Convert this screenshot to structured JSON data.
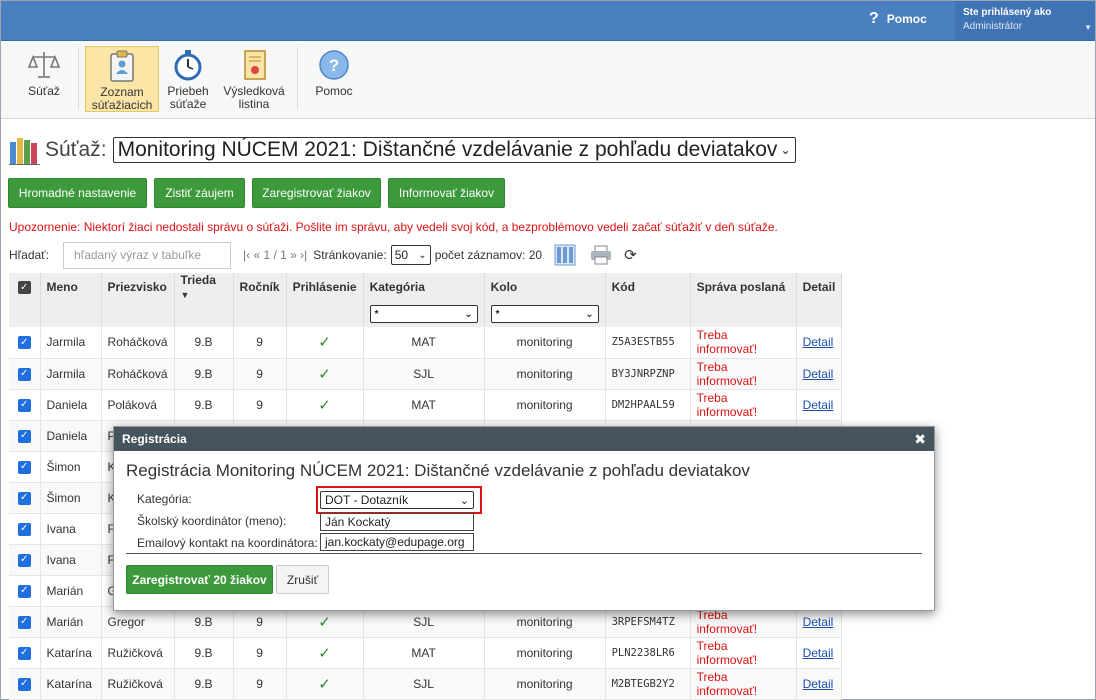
{
  "header": {
    "help": "Pomoc",
    "logged_in_label": "Ste prihlásený ako",
    "user": "Administrátor"
  },
  "toolbar": {
    "items": [
      {
        "label1": "Súťaž",
        "label2": "",
        "icon": "scales-icon"
      },
      {
        "label1": "Zoznam",
        "label2": "súťažiacich",
        "icon": "clipboard-icon"
      },
      {
        "label1": "Priebeh",
        "label2": "súťaže",
        "icon": "stopwatch-icon"
      },
      {
        "label1": "Výsledková",
        "label2": "listina",
        "icon": "certificate-icon"
      },
      {
        "label1": "Pomoc",
        "label2": "",
        "icon": "help-icon"
      }
    ]
  },
  "contest": {
    "label": "Súťaž:",
    "selected": "Monitoring NÚCEM 2021: Dištančné vzdelávanie z pohľadu deviatakov"
  },
  "actions": {
    "bulk": "Hromadné nastavenie",
    "interest": "Zistiť záujem",
    "register": "Zaregistrovať žiakov",
    "inform": "Informovať žiakov"
  },
  "warning": "Upozornenie: Niektorí žiaci nedostali správu o súťaži. Pošlite im správu, aby vedeli svoj kód, a bezproblémovo vedeli začať súťažiť v deň súťaže.",
  "search": {
    "label": "Hľadať:",
    "placeholder": "hľadaný výraz v tabuľke",
    "pager": "|‹ « 1 / 1 » ›|",
    "paging_label": "Stránkovanie:",
    "per_page": "50",
    "count": "počet záznamov: 20"
  },
  "table": {
    "headers": {
      "first": "Meno",
      "last": "Priezvisko",
      "class": "Trieda",
      "year": "Ročník",
      "login": "Prihlásenie",
      "category": "Kategória",
      "round": "Kolo",
      "code": "Kód",
      "msg": "Správa poslaná",
      "detail": "Detail"
    },
    "filter_all": "*",
    "detail_link": "Detail",
    "msg_status": "Treba informovať!",
    "rows": [
      {
        "first": "Jarmila",
        "last": "Roháčková",
        "class": "9.B",
        "year": "9",
        "category": "MAT",
        "round": "monitoring",
        "code": "Z5A3ESTB55"
      },
      {
        "first": "Jarmila",
        "last": "Roháčková",
        "class": "9.B",
        "year": "9",
        "category": "SJL",
        "round": "monitoring",
        "code": "BY3JNRPZNP"
      },
      {
        "first": "Daniela",
        "last": "Poláková",
        "class": "9.B",
        "year": "9",
        "category": "MAT",
        "round": "monitoring",
        "code": "DM2HPAAL59"
      },
      {
        "first": "Daniela",
        "last": "P",
        "class": "",
        "year": "",
        "category": "",
        "round": "",
        "code": ""
      },
      {
        "first": "Šimon",
        "last": "K",
        "class": "",
        "year": "",
        "category": "",
        "round": "",
        "code": ""
      },
      {
        "first": "Šimon",
        "last": "K",
        "class": "",
        "year": "",
        "category": "",
        "round": "",
        "code": ""
      },
      {
        "first": "Ivana",
        "last": "F",
        "class": "",
        "year": "",
        "category": "",
        "round": "",
        "code": ""
      },
      {
        "first": "Ivana",
        "last": "F",
        "class": "",
        "year": "",
        "category": "",
        "round": "",
        "code": ""
      },
      {
        "first": "Marián",
        "last": "G",
        "class": "",
        "year": "",
        "category": "",
        "round": "",
        "code": ""
      },
      {
        "first": "Marián",
        "last": "Gregor",
        "class": "9.B",
        "year": "9",
        "category": "SJL",
        "round": "monitoring",
        "code": "3RPEFSM4TZ"
      },
      {
        "first": "Katarína",
        "last": "Ružičková",
        "class": "9.B",
        "year": "9",
        "category": "MAT",
        "round": "monitoring",
        "code": "PLN2238LR6"
      },
      {
        "first": "Katarína",
        "last": "Ružičková",
        "class": "9.B",
        "year": "9",
        "category": "SJL",
        "round": "monitoring",
        "code": "M2BTEGB2Y2"
      }
    ]
  },
  "modal": {
    "header": "Registrácia",
    "title": "Registrácia Monitoring NÚCEM 2021: Dištančné vzdelávanie z pohľadu deviatakov",
    "category_label": "Kategória:",
    "category_value": "DOT - Dotazník",
    "coordinator_label": "Školský koordinátor (meno):",
    "coordinator_value": "Ján Kockatý",
    "email_label": "Emailový kontakt na koordinátora:",
    "email_value": "jan.kockaty@edupage.org",
    "submit": "Zaregistrovať 20 žiakov",
    "cancel": "Zrušiť"
  }
}
